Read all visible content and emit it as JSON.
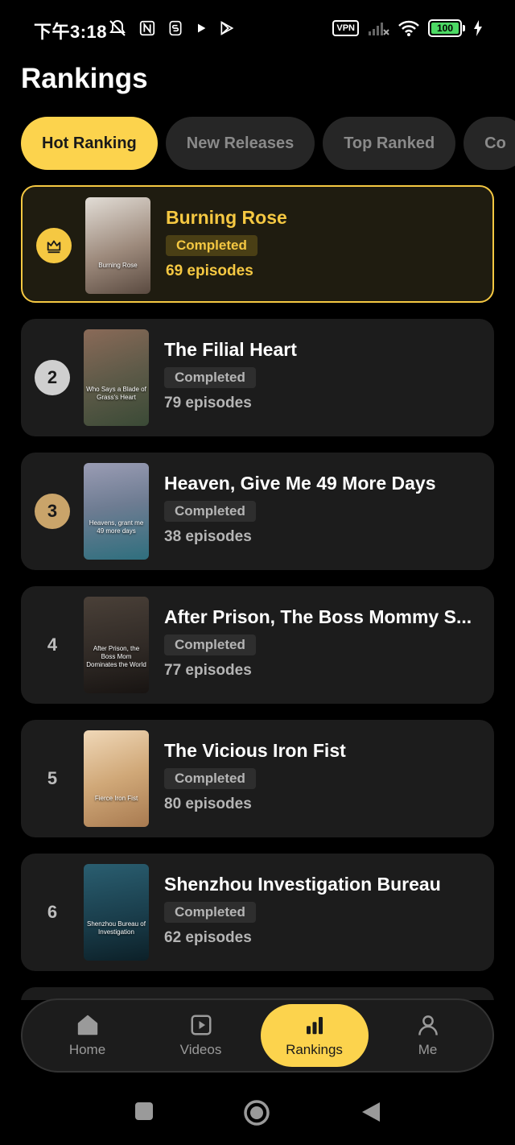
{
  "status_bar": {
    "time": "下午3:18",
    "vpn": "VPN",
    "battery": "100"
  },
  "page": {
    "title": "Rankings"
  },
  "tabs": [
    {
      "label": "Hot Ranking",
      "active": true
    },
    {
      "label": "New Releases",
      "active": false
    },
    {
      "label": "Top Ranked",
      "active": false
    },
    {
      "label": "Co",
      "active": false
    }
  ],
  "rankings": [
    {
      "rank": "1",
      "title": "Burning Rose",
      "status": "Completed",
      "episodes": "69 episodes",
      "poster_caption": "Burning Rose",
      "colors": [
        "#d9d3cc",
        "#6e5a4e"
      ]
    },
    {
      "rank": "2",
      "title": "The Filial Heart",
      "status": "Completed",
      "episodes": "79 episodes",
      "poster_caption": "Who Says a Blade of Grass's Heart",
      "colors": [
        "#7a5b4a",
        "#3d4a36"
      ]
    },
    {
      "rank": "3",
      "title": "Heaven, Give Me 49 More Days",
      "status": "Completed",
      "episodes": "38 episodes",
      "poster_caption": "Heavens, grant me 49 more days",
      "colors": [
        "#8f92a8",
        "#2f6f7e"
      ]
    },
    {
      "rank": "4",
      "title": "After Prison, The Boss Mommy S...",
      "status": "Completed",
      "episodes": "77 episodes",
      "poster_caption": "After Prison, the Boss Mom Dominates the World",
      "colors": [
        "#3a3330",
        "#1f1a18"
      ]
    },
    {
      "rank": "5",
      "title": "The Vicious Iron Fist",
      "status": "Completed",
      "episodes": "80 episodes",
      "poster_caption": "Fierce Iron Fist",
      "colors": [
        "#e8cba6",
        "#b8875a"
      ]
    },
    {
      "rank": "6",
      "title": "Shenzhou Investigation Bureau",
      "status": "Completed",
      "episodes": "62 episodes",
      "poster_caption": "Shenzhou Bureau of Investigation",
      "colors": [
        "#1f4a5a",
        "#0e2a33"
      ]
    }
  ],
  "bottom_nav": [
    {
      "label": "Home",
      "icon": "home-icon",
      "active": false
    },
    {
      "label": "Videos",
      "icon": "video-icon",
      "active": false
    },
    {
      "label": "Rankings",
      "icon": "bar-chart-icon",
      "active": true
    },
    {
      "label": "Me",
      "icon": "person-icon",
      "active": false
    }
  ],
  "colors": {
    "accent": "#fcd34d",
    "card": "#1c1c1c",
    "background": "#000000"
  }
}
